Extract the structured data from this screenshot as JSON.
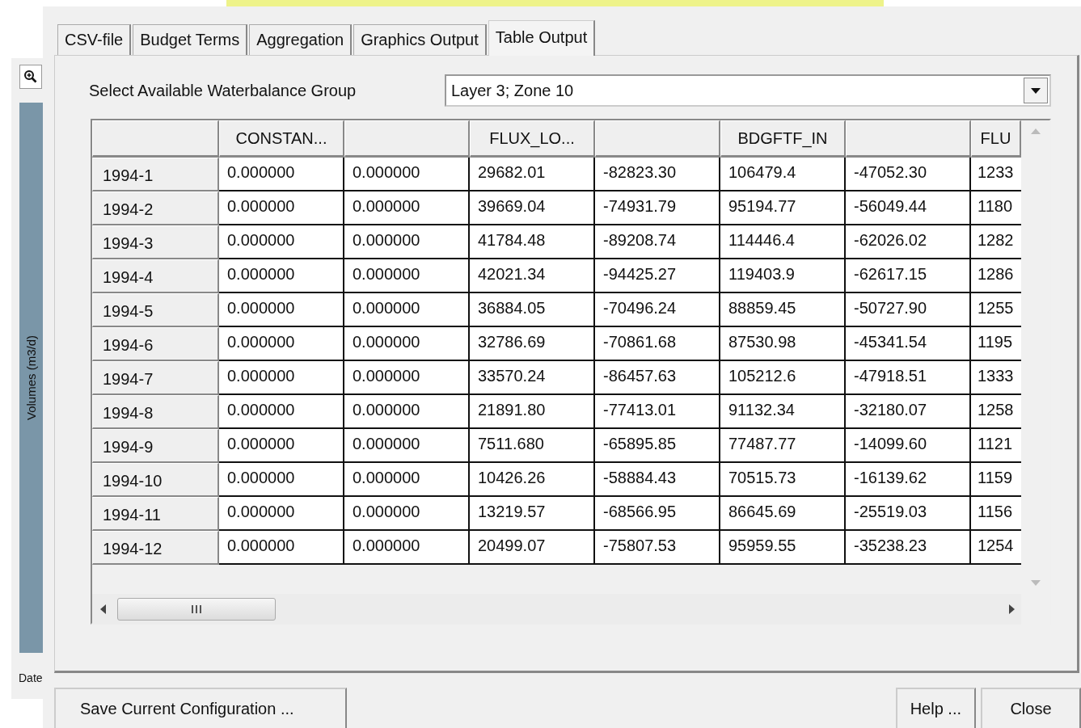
{
  "background": {
    "axis_label": "Volumes (m3/d)",
    "date_label": "Date"
  },
  "tabs": [
    {
      "label": "CSV-file",
      "selected": false
    },
    {
      "label": "Budget Terms",
      "selected": false
    },
    {
      "label": "Aggregation",
      "selected": false
    },
    {
      "label": "Graphics Output",
      "selected": false
    },
    {
      "label": "Table Output",
      "selected": true
    }
  ],
  "group_select": {
    "label": "Select Available Waterbalance Group",
    "value": "Layer 3; Zone 10"
  },
  "table": {
    "columns": [
      "",
      "CONSTAN...",
      "",
      "FLUX_LO...",
      "",
      "BDGFTF_IN",
      "",
      "FLU"
    ],
    "rows": [
      [
        "1994-1",
        "0.000000",
        "0.000000",
        "29682.01",
        "-82823.30",
        "106479.4",
        "-47052.30",
        "1233"
      ],
      [
        "1994-2",
        "0.000000",
        "0.000000",
        "39669.04",
        "-74931.79",
        "95194.77",
        "-56049.44",
        "1180"
      ],
      [
        "1994-3",
        "0.000000",
        "0.000000",
        "41784.48",
        "-89208.74",
        "114446.4",
        "-62026.02",
        "1282"
      ],
      [
        "1994-4",
        "0.000000",
        "0.000000",
        "42021.34",
        "-94425.27",
        "119403.9",
        "-62617.15",
        "1286"
      ],
      [
        "1994-5",
        "0.000000",
        "0.000000",
        "36884.05",
        "-70496.24",
        "88859.45",
        "-50727.90",
        "1255"
      ],
      [
        "1994-6",
        "0.000000",
        "0.000000",
        "32786.69",
        "-70861.68",
        "87530.98",
        "-45341.54",
        "1195"
      ],
      [
        "1994-7",
        "0.000000",
        "0.000000",
        "33570.24",
        "-86457.63",
        "105212.6",
        "-47918.51",
        "1333"
      ],
      [
        "1994-8",
        "0.000000",
        "0.000000",
        "21891.80",
        "-77413.01",
        "91132.34",
        "-32180.07",
        "1258"
      ],
      [
        "1994-9",
        "0.000000",
        "0.000000",
        "7511.680",
        "-65895.85",
        "77487.77",
        "-14099.60",
        "1121"
      ],
      [
        "1994-10",
        "0.000000",
        "0.000000",
        "10426.26",
        "-58884.43",
        "70515.73",
        "-16139.62",
        "1159"
      ],
      [
        "1994-11",
        "0.000000",
        "0.000000",
        "13219.57",
        "-68566.95",
        "86645.69",
        "-25519.03",
        "1156"
      ],
      [
        "1994-12",
        "0.000000",
        "0.000000",
        "20499.07",
        "-75807.53",
        "95959.55",
        "-35238.23",
        "1254"
      ]
    ]
  },
  "buttons": [
    {
      "label": "Save Current Configuration ...",
      "kind": "left"
    },
    {
      "label": "Help ...",
      "kind": "right"
    },
    {
      "label": "Close",
      "kind": "right"
    }
  ]
}
